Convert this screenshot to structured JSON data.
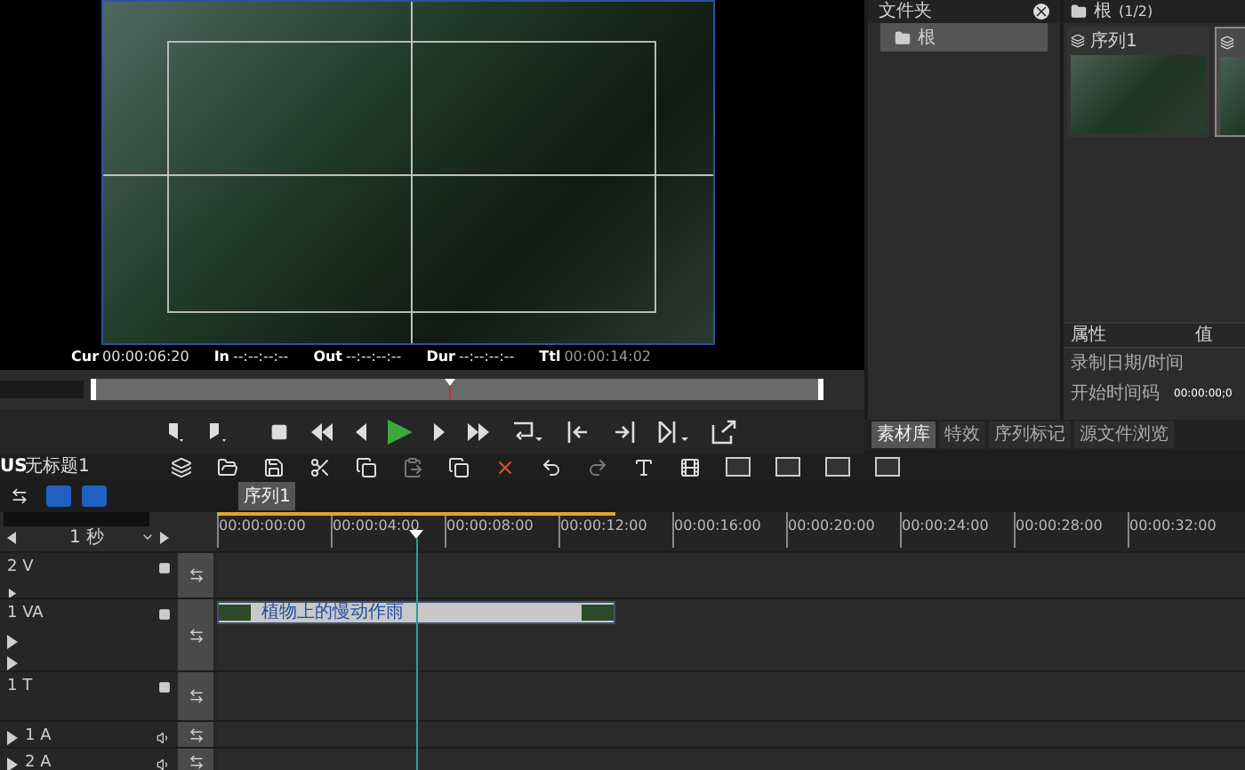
{
  "preview": {
    "timecodes": [
      {
        "label": "Cur",
        "value": "00:00:06:20"
      },
      {
        "label": "In",
        "value": "--:--:--:--"
      },
      {
        "label": "Out",
        "value": "--:--:--:--"
      },
      {
        "label": "Dur",
        "value": "--:--:--:--"
      },
      {
        "label": "Ttl",
        "value": "00:00:14:02"
      }
    ],
    "scrubber": {
      "level": 0.49
    }
  },
  "folder_panel": {
    "title": "文件夹",
    "items": [
      {
        "label": "根",
        "selected": true
      }
    ]
  },
  "bin_panel": {
    "title": "根",
    "count": "(1/2)",
    "items": [
      {
        "label": "序列1",
        "selected": false
      },
      {
        "selected": true
      }
    ],
    "properties": {
      "columns": [
        "属性",
        "值"
      ],
      "rows": [
        {
          "name": "录制日期/时间"
        },
        {
          "name": "开始时间码",
          "value": "00:00:00;0"
        }
      ]
    }
  },
  "panel_tabs": [
    {
      "label": "素材库",
      "selected": true
    },
    {
      "label": "特效",
      "selected": false
    },
    {
      "label": "序列标记",
      "selected": false
    },
    {
      "label": "源文件浏览",
      "selected": false
    }
  ],
  "project": {
    "app": "US",
    "name": "无标题1"
  },
  "sequence_tabs": [
    {
      "label": "序列1",
      "selected": true
    }
  ],
  "timeline": {
    "scale": "1 秒",
    "ruler": [
      "00:00:00:00",
      "00:00:04:00",
      "00:00:08:00",
      "00:00:12:00",
      "00:00:16:00",
      "00:00:20:00",
      "00:00:24:00",
      "00:00:28:00",
      "00:00:32:00"
    ],
    "tracks": [
      {
        "name": "2 V",
        "kind": "video"
      },
      {
        "name": "1 VA",
        "kind": "videoaudio",
        "clip": "植物上的慢动作雨"
      },
      {
        "name": "1 T",
        "kind": "title"
      },
      {
        "name": "1 A",
        "kind": "audio"
      },
      {
        "name": "2 A",
        "kind": "audio"
      }
    ]
  }
}
